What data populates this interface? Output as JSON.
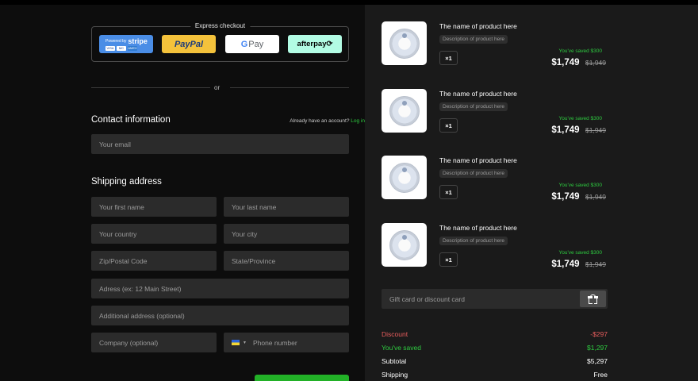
{
  "express": {
    "label": "Express checkout",
    "stripe": {
      "prefix": "Powered by",
      "brand": "stripe",
      "cards": [
        "VISA",
        "MC",
        "AMEX"
      ]
    },
    "paypal": "PayPal",
    "gpay": {
      "g": "G",
      "pay": "Pay"
    },
    "afterpay": "afterpay⟳"
  },
  "or_label": "or",
  "contact": {
    "title": "Contact information",
    "account_text": "Already have an account?",
    "login_link": "Log in",
    "email_placeholder": "Your email"
  },
  "shipping": {
    "title": "Shipping address",
    "first_name": "Your first name",
    "last_name": "Your last name",
    "country": "Your country",
    "city": "Your city",
    "zip": "Zip/Postal Code",
    "state": "State/Province",
    "address": "Adress (ex: 12 Main Street)",
    "address2": "Additional address (optional)",
    "company": "Company (optional)",
    "phone": "Phone number"
  },
  "products": [
    {
      "name": "The name of product here",
      "description": "Description of product here",
      "qty": "×1",
      "saved": "You've saved $300",
      "price": "$1,749",
      "old_price": "$1,949"
    },
    {
      "name": "The name of product here",
      "description": "Description of product here",
      "qty": "×1",
      "saved": "You've saved $300",
      "price": "$1,749",
      "old_price": "$1,949"
    },
    {
      "name": "The name of product here",
      "description": "Description of product here",
      "qty": "×1",
      "saved": "You've saved $300",
      "price": "$1,749",
      "old_price": "$1,949"
    },
    {
      "name": "The name of product here",
      "description": "Description of product here",
      "qty": "×1",
      "saved": "You've saved $300",
      "price": "$1,749",
      "old_price": "$1,949"
    }
  ],
  "gift_placeholder": "Gift card or discount card",
  "summary": {
    "discount_label": "Discount",
    "discount_value": "-$297",
    "saved_label": "You've saved",
    "saved_value": "$1,297",
    "subtotal_label": "Subtotal",
    "subtotal_value": "$5,297",
    "shipping_label": "Shipping",
    "shipping_value": "Free"
  },
  "colors": {
    "accent_green": "#2ecc40",
    "discount_red": "#e85d5d",
    "field_bg": "#2b2b2b"
  }
}
